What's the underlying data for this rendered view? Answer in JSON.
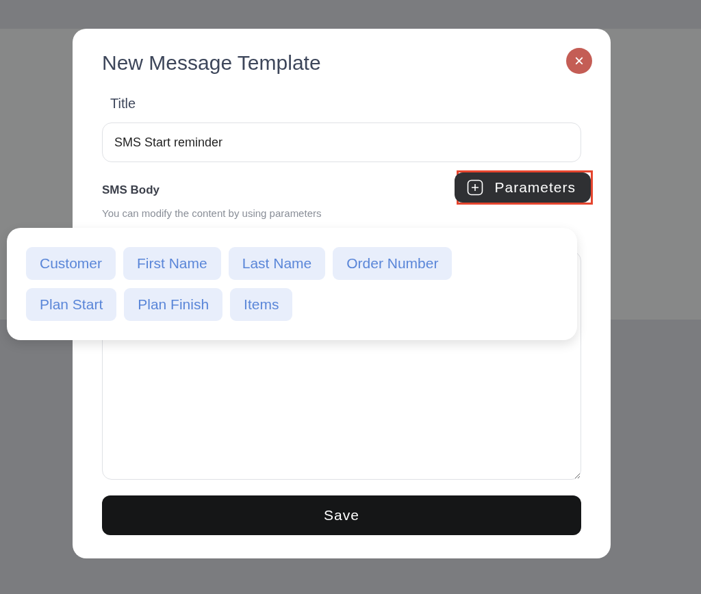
{
  "dialog": {
    "title": "New Message Template",
    "close_label": "×"
  },
  "title_field": {
    "label": "Title",
    "value": "SMS Start reminder"
  },
  "body_section": {
    "label": "SMS Body",
    "hint": "You can modify the content by using parameters"
  },
  "parameters_button": {
    "label": "Parameters",
    "highlighted": true
  },
  "parameters_popover": {
    "chips": [
      {
        "label": "Customer"
      },
      {
        "label": "First Name"
      },
      {
        "label": "Last Name"
      },
      {
        "label": "Order Number"
      },
      {
        "label": "Plan Start"
      },
      {
        "label": "Plan Finish"
      },
      {
        "label": "Items"
      }
    ]
  },
  "save_button": {
    "label": "Save"
  }
}
